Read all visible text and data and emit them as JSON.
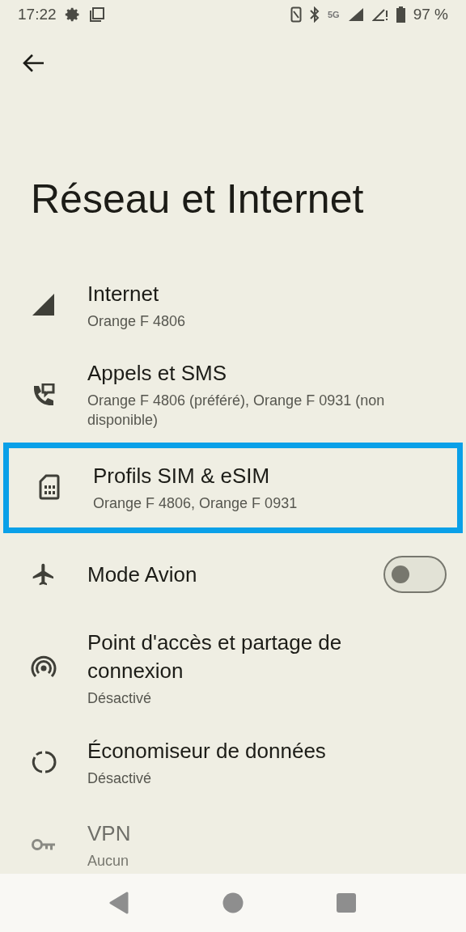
{
  "status_bar": {
    "time": "17:22",
    "network": "5G",
    "battery": "97 %"
  },
  "page": {
    "title": "Réseau et Internet"
  },
  "items": [
    {
      "kind": "link",
      "title": "Internet",
      "subtitle": "Orange F 4806",
      "highlighted": false
    },
    {
      "kind": "link",
      "title": "Appels et SMS",
      "subtitle": "Orange F 4806 (préféré), Orange F 0931 (non disponible)",
      "highlighted": false
    },
    {
      "kind": "link",
      "title": "Profils SIM & eSIM",
      "subtitle": "Orange F 4806, Orange F 0931",
      "highlighted": true
    },
    {
      "kind": "toggle",
      "title": "Mode Avion",
      "on": false,
      "highlighted": false
    },
    {
      "kind": "link",
      "title": "Point d'accès et partage de connexion",
      "subtitle": "Désactivé",
      "highlighted": false
    },
    {
      "kind": "link",
      "title": "Économiseur de données",
      "subtitle": "Désactivé",
      "highlighted": false
    },
    {
      "kind": "link",
      "title": "VPN",
      "subtitle": "Aucun",
      "highlighted": false
    }
  ]
}
